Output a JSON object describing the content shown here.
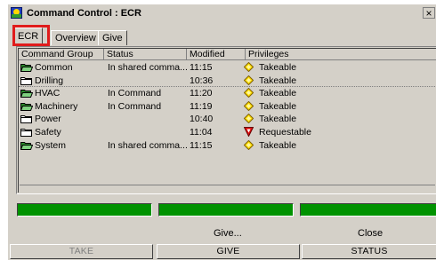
{
  "window": {
    "title": "Command Control : ECR",
    "close_glyph": "×"
  },
  "tabs": [
    {
      "label": "ECR",
      "active": true
    },
    {
      "label": "Overview",
      "active": false
    },
    {
      "label": "Give",
      "active": false
    }
  ],
  "table": {
    "columns": [
      "Command Group",
      "Status",
      "Modified",
      "Privileges"
    ],
    "rows": [
      {
        "group": "Common",
        "status": "In shared comma...",
        "modified": "11:15",
        "privilege": "Takeable",
        "folder": "open-green",
        "priv_icon": "takeable-diamond-icon"
      },
      {
        "group": "Drilling",
        "status": "",
        "modified": "10:36",
        "privilege": "Takeable",
        "folder": "closed",
        "priv_icon": "takeable-diamond-icon"
      },
      {
        "group": "HVAC",
        "status": "In Command",
        "modified": "11:20",
        "privilege": "Takeable",
        "folder": "open-green",
        "priv_icon": "takeable-diamond-icon"
      },
      {
        "group": "Machinery",
        "status": "In Command",
        "modified": "11:19",
        "privilege": "Takeable",
        "folder": "open-green",
        "priv_icon": "takeable-diamond-icon"
      },
      {
        "group": "Power",
        "status": "",
        "modified": "10:40",
        "privilege": "Takeable",
        "folder": "closed",
        "priv_icon": "takeable-diamond-icon"
      },
      {
        "group": "Safety",
        "status": "",
        "modified": "11:04",
        "privilege": "Requestable",
        "folder": "closed",
        "priv_icon": "requestable-triangle-icon"
      },
      {
        "group": "System",
        "status": "In shared comma...",
        "modified": "11:15",
        "privilege": "Takeable",
        "folder": "open-green",
        "priv_icon": "takeable-diamond-icon"
      }
    ]
  },
  "status_bars": {
    "color": "#009200",
    "count": 3
  },
  "sublabels": {
    "give": "Give...",
    "close": "Close"
  },
  "buttons": {
    "take": "TAKE",
    "give": "GIVE",
    "status": "STATUS"
  }
}
